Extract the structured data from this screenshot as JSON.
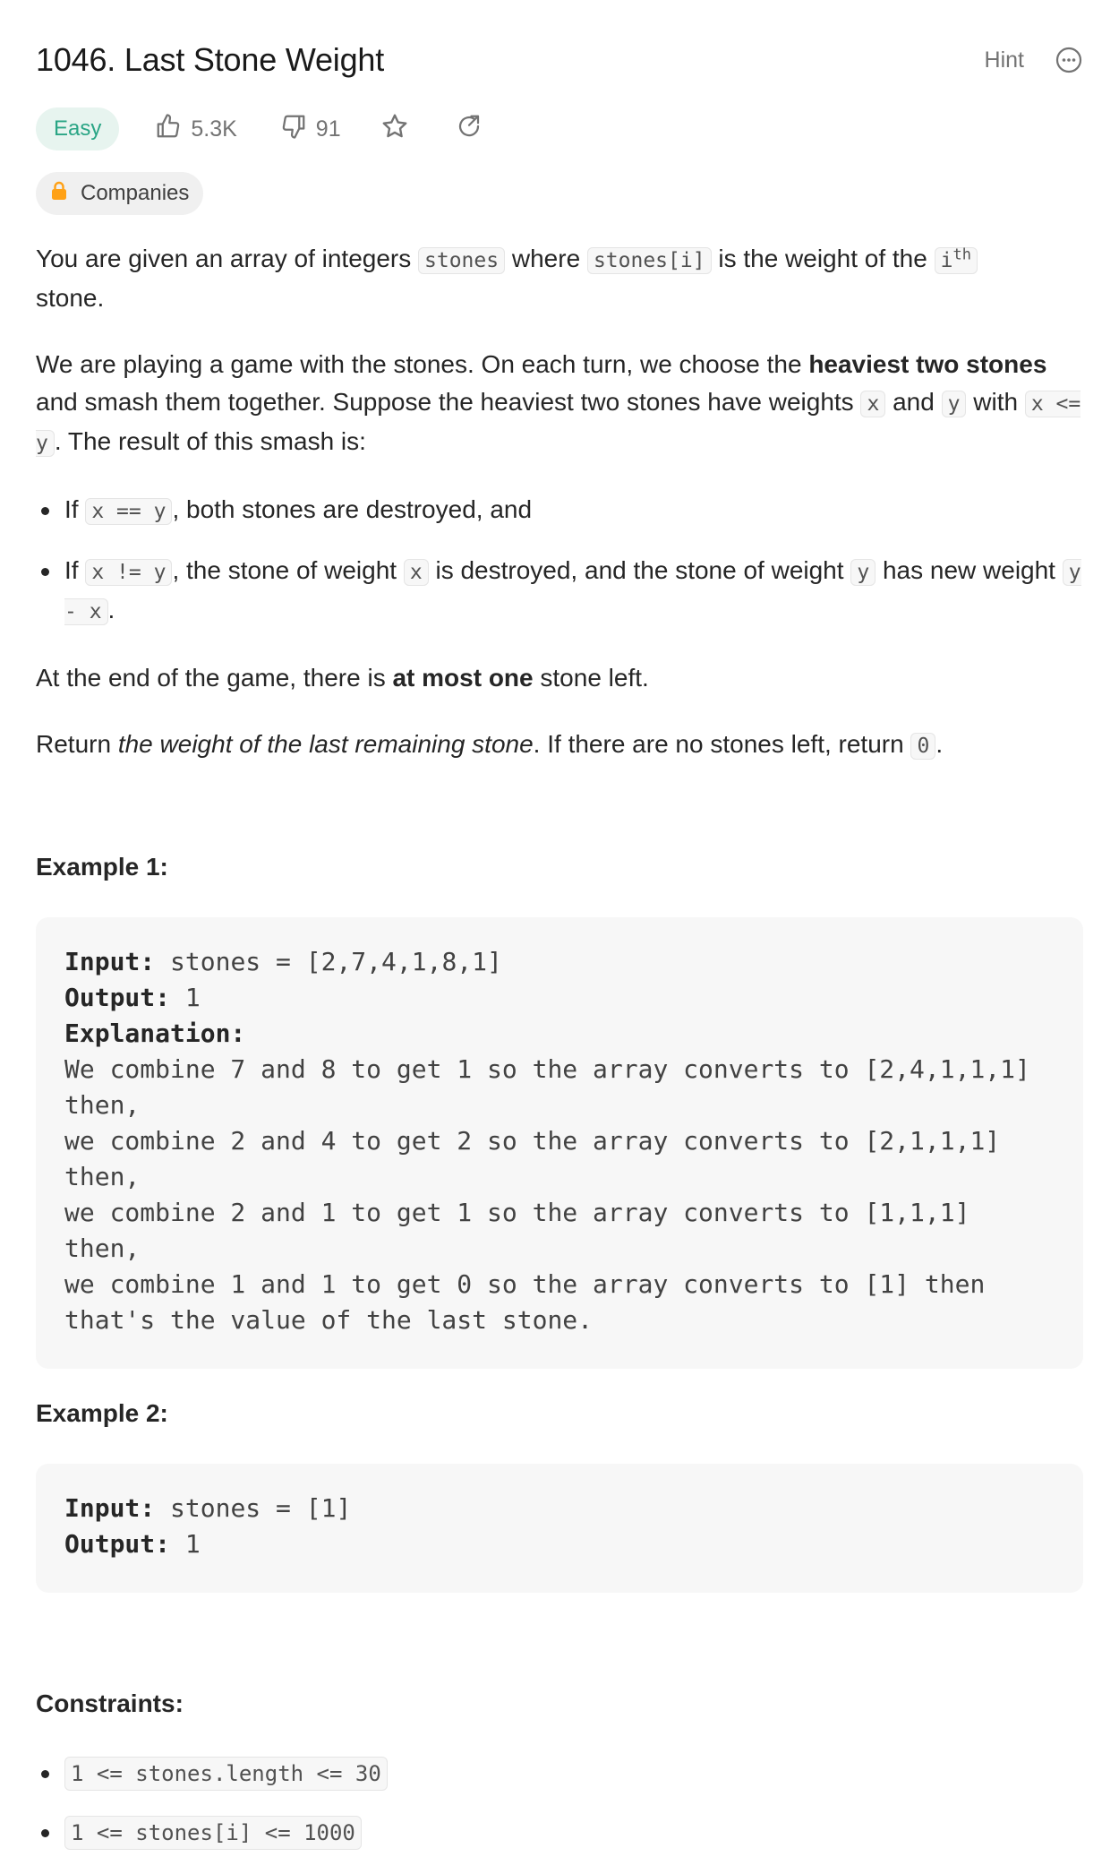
{
  "header": {
    "title": "1046. Last Stone Weight",
    "hint_label": "Hint"
  },
  "meta": {
    "difficulty": "Easy",
    "likes": "5.3K",
    "dislikes": "91"
  },
  "companies_label": "Companies",
  "description": {
    "p1": {
      "t1": "You are given an array of integers ",
      "c1": "stones",
      "t2": " where ",
      "c2": "stones[i]",
      "t3": " is the weight of the ",
      "c3": "i",
      "sup": "th",
      "t4": " stone."
    },
    "p2": {
      "t1": "We are playing a game with the stones. On each turn, we choose the ",
      "b1": "heaviest two stones",
      "t2": " and smash them together. Suppose the heaviest two stones have weights ",
      "c1": "x",
      "t3": " and ",
      "c2": "y",
      "t4": " with ",
      "c3": "x <= y",
      "t5": ". The result of this smash is:"
    },
    "bullet1": {
      "t1": "If ",
      "c1": "x == y",
      "t2": ", both stones are destroyed, and"
    },
    "bullet2": {
      "t1": "If ",
      "c1": "x != y",
      "t2": ", the stone of weight ",
      "c2": "x",
      "t3": " is destroyed, and the stone of weight ",
      "c3": "y",
      "t4": " has new weight ",
      "c4": "y - x",
      "t5": "."
    },
    "p3": {
      "t1": "At the end of the game, there is ",
      "b1": "at most one",
      "t2": " stone left."
    },
    "p4": {
      "t1": "Return ",
      "i1": "the weight of the last remaining stone",
      "t2": ". If there are no stones left, return ",
      "c1": "0",
      "t3": "."
    }
  },
  "example1": {
    "title": "Example 1:",
    "input_label": "Input:",
    "input_value": " stones = [2,7,4,1,8,1]",
    "output_label": "Output:",
    "output_value": " 1",
    "explanation_label": "Explanation:",
    "explanation_text": "We combine 7 and 8 to get 1 so the array converts to [2,4,1,1,1] then,\nwe combine 2 and 4 to get 2 so the array converts to [2,1,1,1] then,\nwe combine 2 and 1 to get 1 so the array converts to [1,1,1] then,\nwe combine 1 and 1 to get 0 so the array converts to [1] then that's the value of the last stone."
  },
  "example2": {
    "title": "Example 2:",
    "input_label": "Input:",
    "input_value": " stones = [1]",
    "output_label": "Output:",
    "output_value": " 1"
  },
  "constraints": {
    "title": "Constraints:",
    "items": [
      "1 <= stones.length <= 30",
      "1 <= stones[i] <= 1000"
    ]
  },
  "colors": {
    "easy": "#2aa585",
    "easy_bg": "#e7f4ef",
    "lock": "#ffa116"
  }
}
